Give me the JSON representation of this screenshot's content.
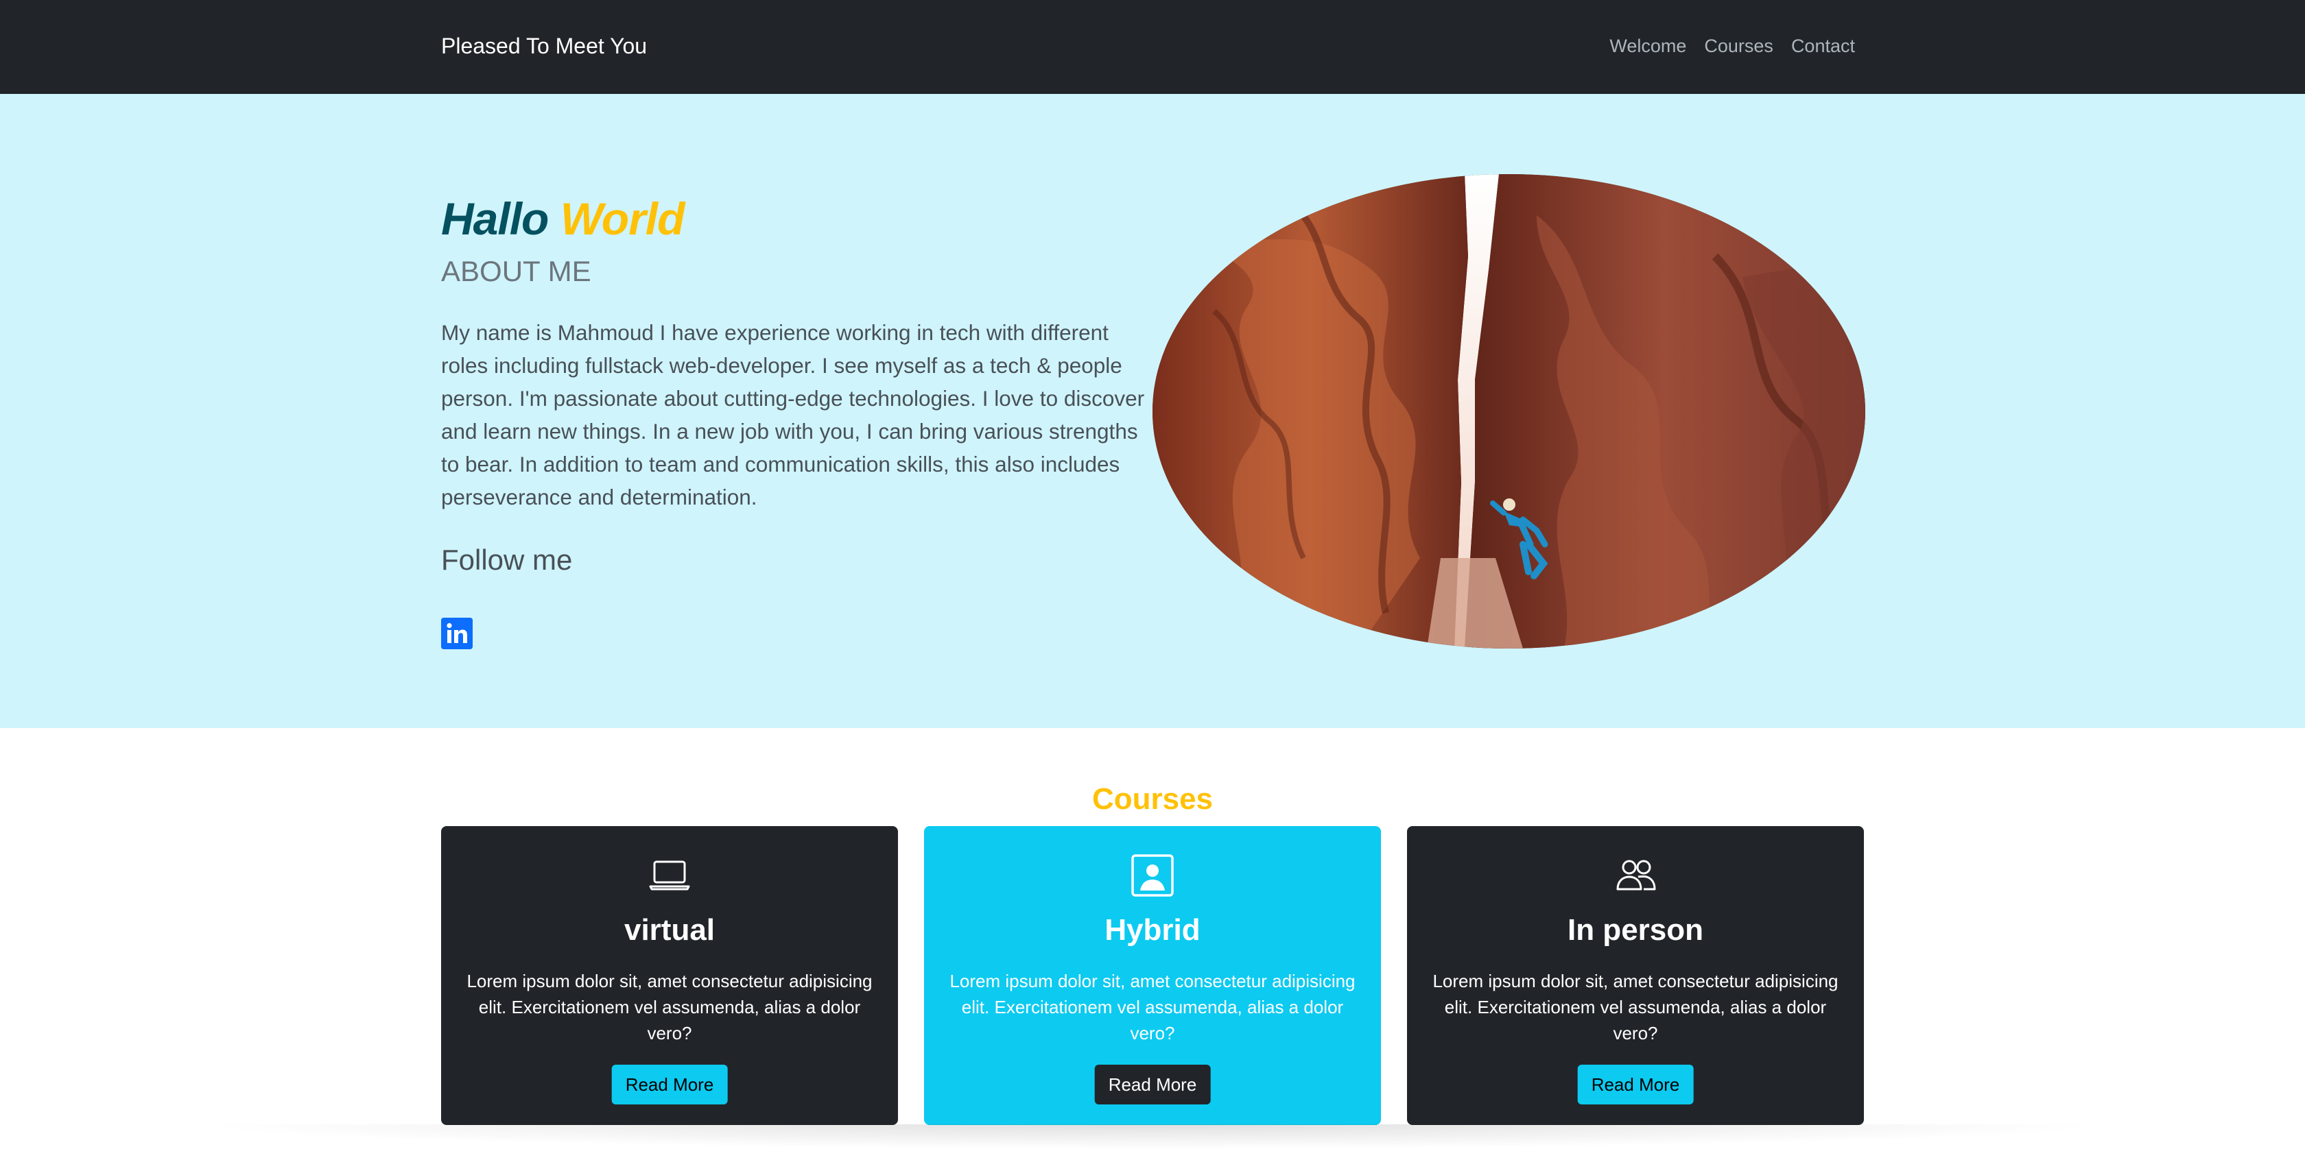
{
  "navbar": {
    "brand": "Pleased To Meet You",
    "links": [
      "Welcome",
      "Courses",
      "Contact"
    ]
  },
  "hero": {
    "title_word1": "Hallo",
    "title_word2": "World",
    "about_title": "ABOUT ME",
    "about_text": "My name is Mahmoud I have experience working in tech with different roles including fullstack web-developer. I see myself as a tech & people person. I'm passionate about cutting-edge technologies. I love to discover and learn new things. In a new job with you, I can bring various strengths to bear. In addition to team and communication skills, this also includes perseverance and determination.",
    "follow_title": "Follow me",
    "social_icon": "linkedin-icon",
    "image_subject": "rock climber in a red sandstone slot canyon"
  },
  "courses": {
    "title": "Courses",
    "cards": [
      {
        "icon": "laptop-icon",
        "title": "virtual",
        "text": "Lorem ipsum dolor sit, amet consectetur adipisicing elit. Exercitationem vel assumenda, alias a dolor vero?",
        "button": "Read More",
        "theme": "dark"
      },
      {
        "icon": "person-badge-icon",
        "title": "Hybrid",
        "text": "Lorem ipsum dolor sit, amet consectetur adipisicing elit. Exercitationem vel assumenda, alias a dolor vero?",
        "button": "Read More",
        "theme": "cyan"
      },
      {
        "icon": "people-icon",
        "title": "In person",
        "text": "Lorem ipsum dolor sit, amet consectetur adipisicing elit. Exercitationem vel assumenda, alias a dolor vero?",
        "button": "Read More",
        "theme": "dark"
      }
    ]
  },
  "colors": {
    "navbar_bg": "#212529",
    "hero_bg": "#cff4fc",
    "accent_yellow": "#ffc107",
    "accent_cyan": "#0dcaf0",
    "title_dark_teal": "#055160",
    "linkedin_blue": "#0d6efd"
  }
}
